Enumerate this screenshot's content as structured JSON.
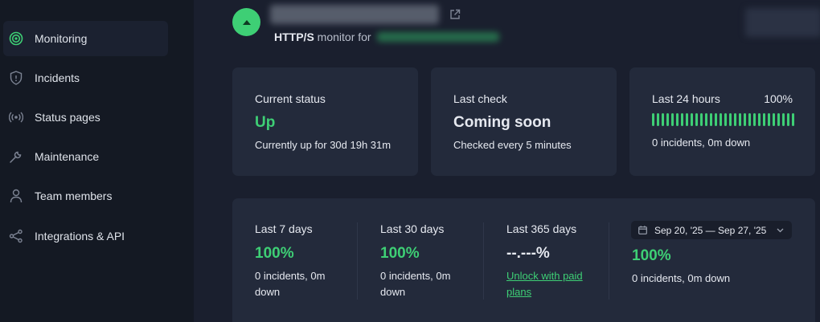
{
  "sidebar": {
    "items": [
      {
        "label": "Monitoring",
        "icon": "target-icon",
        "active": true
      },
      {
        "label": "Incidents",
        "icon": "shield-icon",
        "active": false
      },
      {
        "label": "Status pages",
        "icon": "broadcast-icon",
        "active": false
      },
      {
        "label": "Maintenance",
        "icon": "wrench-icon",
        "active": false
      },
      {
        "label": "Team members",
        "icon": "person-icon",
        "active": false
      },
      {
        "label": "Integrations & API",
        "icon": "nodes-icon",
        "active": false
      }
    ]
  },
  "header": {
    "monitor_type": "HTTP/S",
    "subtitle_rest": "monitor for"
  },
  "status_cards": {
    "current_status": {
      "label": "Current status",
      "value": "Up",
      "detail": "Currently up for 30d 19h 31m"
    },
    "last_check": {
      "label": "Last check",
      "value": "Coming soon",
      "detail": "Checked every 5 minutes"
    },
    "last_24h": {
      "label": "Last 24 hours",
      "percent": "100%",
      "detail": "0 incidents, 0m down",
      "bar_count": 30
    }
  },
  "uptime": {
    "last_7": {
      "label": "Last 7 days",
      "value": "100%",
      "detail": "0 incidents, 0m down"
    },
    "last_30": {
      "label": "Last 30 days",
      "value": "100%",
      "detail": "0 incidents, 0m down"
    },
    "last_365": {
      "label": "Last 365 days",
      "value": "--.---%",
      "link": "Unlock with paid plans"
    },
    "custom": {
      "range": "Sep 20, '25 — Sep 27, '25",
      "value": "100%",
      "detail": "0 incidents, 0m down"
    }
  },
  "colors": {
    "accent": "#3ecf75",
    "card": "#232a3b",
    "background": "#1a1f2e",
    "sidebar": "#141923"
  }
}
